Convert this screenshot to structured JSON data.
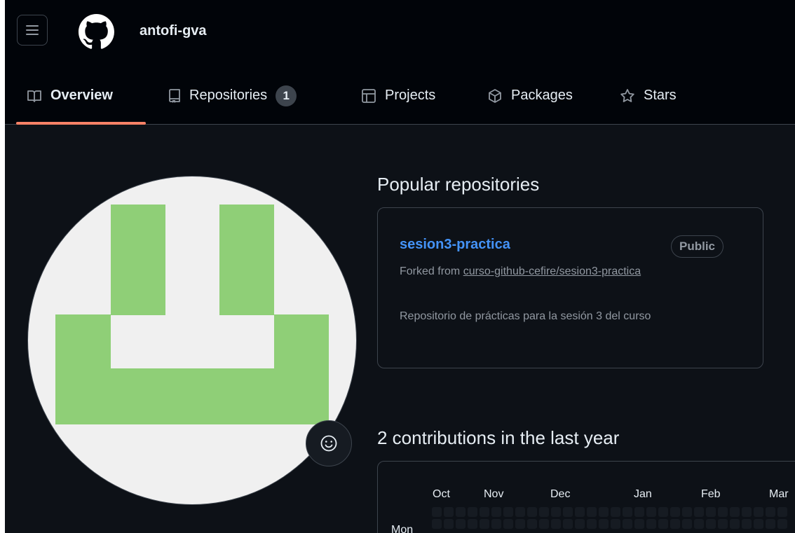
{
  "header": {
    "username": "antofi-gva"
  },
  "tabs": [
    {
      "label": "Overview",
      "icon": "book-icon",
      "active": true
    },
    {
      "label": "Repositories",
      "icon": "repo-icon",
      "count": "1"
    },
    {
      "label": "Projects",
      "icon": "table-icon"
    },
    {
      "label": "Packages",
      "icon": "package-icon"
    },
    {
      "label": "Stars",
      "icon": "star-icon"
    }
  ],
  "popular": {
    "title": "Popular repositories",
    "repo": {
      "name": "sesion3-practica",
      "visibility": "Public",
      "forked_prefix": "Forked from ",
      "forked_source": "curso-github-cefire/sesion3-practica",
      "description": "Repositorio de prácticas para la sesión 3 del curso"
    }
  },
  "contributions": {
    "title": "2 contributions in the last year",
    "months": [
      "Oct",
      "Nov",
      "Dec",
      "Jan",
      "Feb",
      "Mar"
    ],
    "day_label": "Mon"
  },
  "colors": {
    "accent_underline": "#f78166",
    "link": "#4493f8",
    "avatar_green": "#8fcf77",
    "background": "#0d1117"
  }
}
